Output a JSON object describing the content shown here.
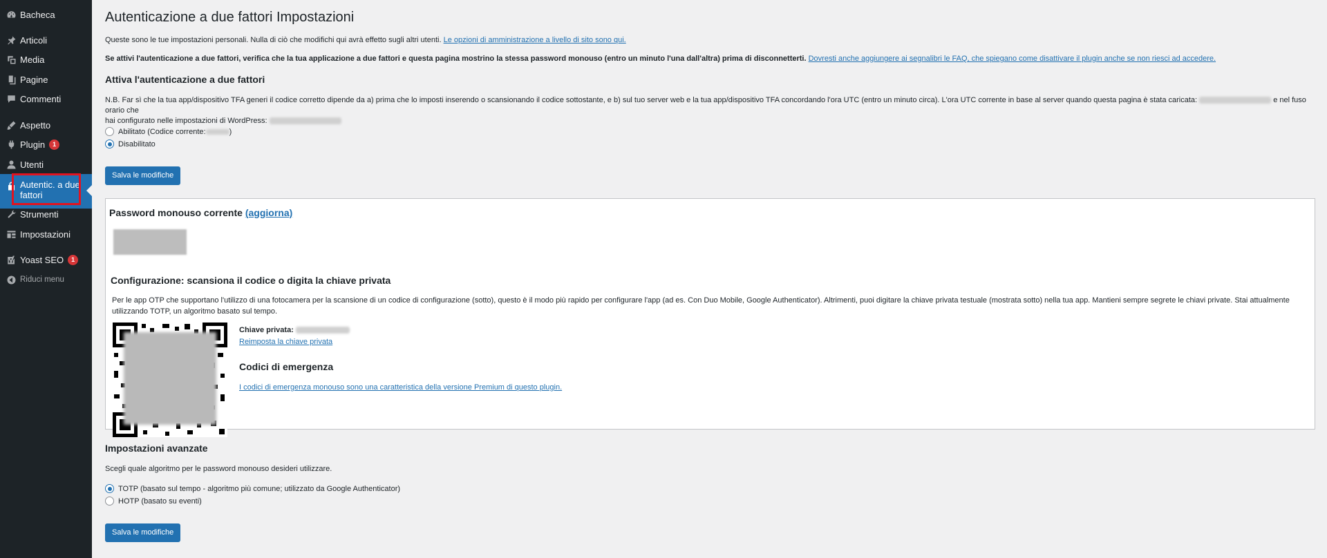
{
  "sidebar": {
    "items": [
      {
        "label": "Bacheca",
        "icon": "dashboard-icon"
      },
      {
        "label": "Articoli",
        "icon": "pin-icon"
      },
      {
        "label": "Media",
        "icon": "media-icon"
      },
      {
        "label": "Pagine",
        "icon": "pages-icon"
      },
      {
        "label": "Commenti",
        "icon": "comments-icon"
      },
      {
        "label": "Aspetto",
        "icon": "appearance-icon"
      },
      {
        "label": "Plugin",
        "icon": "plugins-icon",
        "badge": "1"
      },
      {
        "label": "Utenti",
        "icon": "users-icon"
      },
      {
        "label": "Autentic. a due fattori",
        "icon": "lock-icon",
        "current": true
      },
      {
        "label": "Strumenti",
        "icon": "tools-icon"
      },
      {
        "label": "Impostazioni",
        "icon": "settings-icon"
      },
      {
        "label": "Yoast SEO",
        "icon": "yoast-icon",
        "badge": "1"
      }
    ],
    "collapse_label": "Riduci menu"
  },
  "page": {
    "title": "Autenticazione a due fattori Impostazioni",
    "intro_text": "Queste sono le tue impostazioni personali. Nulla di ciò che modifichi qui avrà effetto sugli altri utenti.",
    "intro_link": "Le opzioni di amministrazione a livello di sito sono qui.",
    "warning_text": "Se attivi l'autenticazione a due fattori, verifica che la tua applicazione a due fattori e questa pagina mostrino la stessa password monouso (entro un minuto l'una dall'altra) prima di disconnetterti.",
    "warning_link": "Dovresti anche aggiungere ai segnalibri le FAQ, che spiegano come disattivare il plugin anche se non riesci ad accedere.",
    "activate_title": "Attiva l'autenticazione a due fattori",
    "nb_text_1": "N.B. Far sì che la tua app/dispositivo TFA generi il codice corretto dipende da a) prima che lo imposti inserendo o scansionando il codice sottostante, e b) sul tuo server web e la tua app/dispositivo TFA concordando l'ora UTC (entro un minuto circa). L'ora UTC corrente in base al server quando questa pagina è stata caricata:",
    "nb_text_2": "e nel fuso orario che",
    "nb_text_3": "hai configurato nelle impostazioni di WordPress:",
    "radio_enabled": "Abilitato (Codice corrente:",
    "radio_disabled": "Disabilitato",
    "save_button": "Salva le modifiche",
    "panel": {
      "otp_title": "Password monouso corrente",
      "otp_refresh": "(aggiorna)",
      "config_title": "Configurazione: scansiona il codice o digita la chiave privata",
      "config_text": "Per le app OTP che supportano l'utilizzo di una fotocamera per la scansione di un codice di configurazione (sotto), questo è il modo più rapido per configurare l'app (ad es. Con Duo Mobile, Google Authenticator). Altrimenti, puoi digitare la chiave privata testuale (mostrata sotto) nella tua app. Mantieni sempre segrete le chiavi private. Stai attualmente utilizzando TOTP, un algoritmo basato sul tempo.",
      "private_key_label": "Chiave privata:",
      "reset_key_link": "Reimposta la chiave privata",
      "emergency_title": "Codici di emergenza",
      "emergency_link": "I codici di emergenza monouso sono una caratteristica della versione Premium di questo plugin."
    },
    "advanced_title": "Impostazioni avanzate",
    "advanced_text": "Scegli quale algoritmo per le password monouso desideri utilizzare.",
    "radio_totp": "TOTP (basato sul tempo - algoritmo più comune; utilizzato da Google Authenticator)",
    "radio_hotp": "HOTP (basato su eventi)"
  },
  "state": {
    "tfa_selected": "Disabilitato",
    "algorithm_selected": "TOTP"
  },
  "colors": {
    "sidebar_bg": "#1d2327",
    "accent": "#2271b1",
    "badge": "#d63638",
    "highlight": "#e3131f"
  }
}
